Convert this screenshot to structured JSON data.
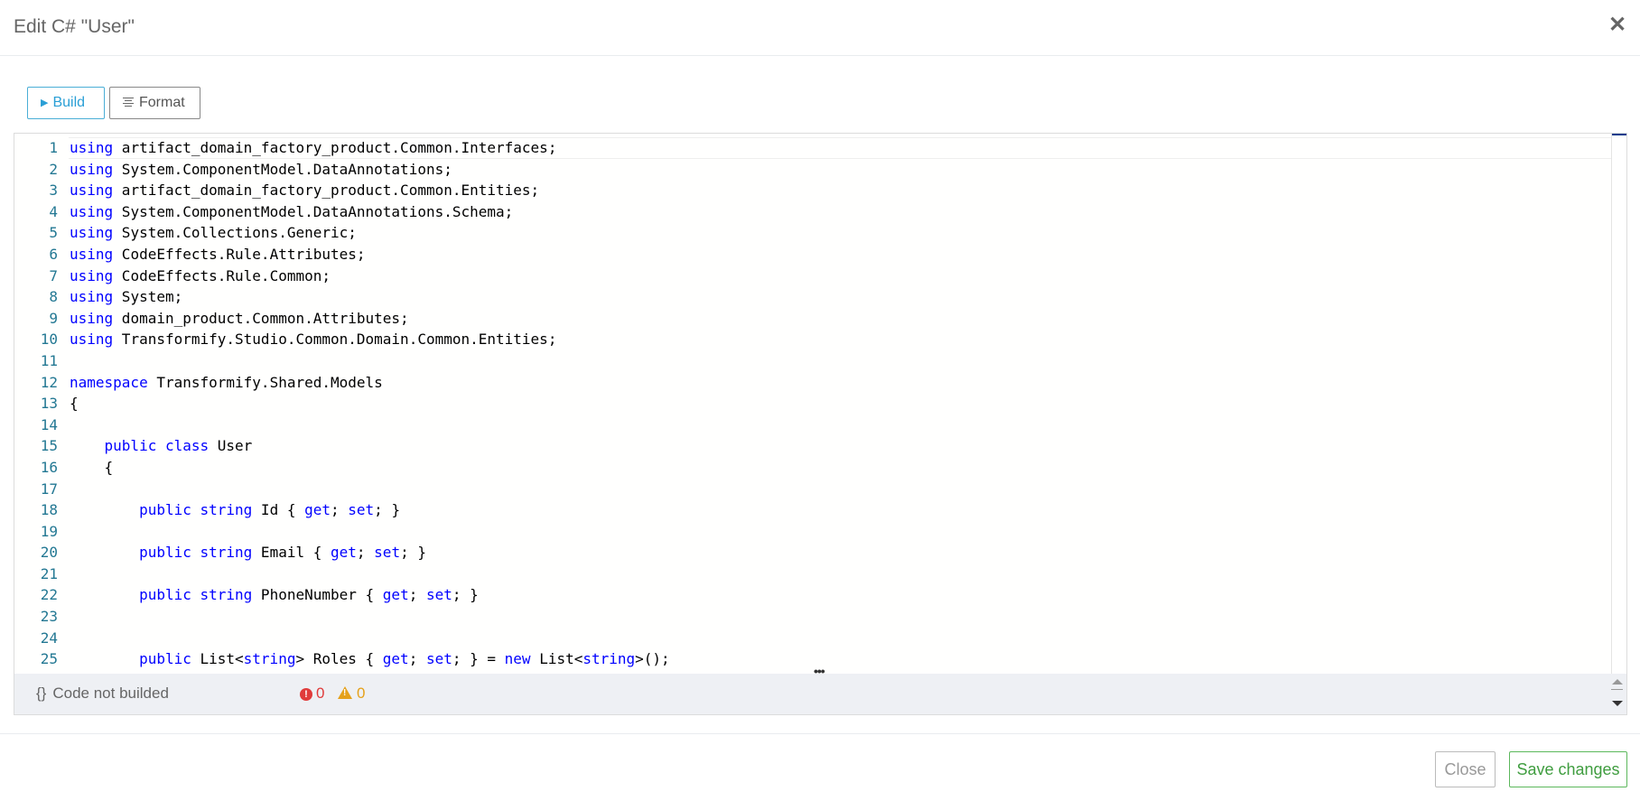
{
  "dialog": {
    "title": "Edit C# \"User\"",
    "close_symbol": "✕"
  },
  "toolbar": {
    "build_label": "Build",
    "format_label": "Format",
    "build_icon": "play-icon",
    "format_icon": "align-center-icon"
  },
  "editor": {
    "language": "C#",
    "lines": [
      {
        "n": "1",
        "indent": "",
        "tokens": [
          [
            "kw",
            "using"
          ],
          [
            "t",
            " artifact_domain_factory_product.Common.Interfaces;"
          ]
        ]
      },
      {
        "n": "2",
        "indent": "",
        "tokens": [
          [
            "kw",
            "using"
          ],
          [
            "t",
            " System.ComponentModel.DataAnnotations;"
          ]
        ]
      },
      {
        "n": "3",
        "indent": "",
        "tokens": [
          [
            "kw",
            "using"
          ],
          [
            "t",
            " artifact_domain_factory_product.Common.Entities;"
          ]
        ]
      },
      {
        "n": "4",
        "indent": "",
        "tokens": [
          [
            "kw",
            "using"
          ],
          [
            "t",
            " System.ComponentModel.DataAnnotations.Schema;"
          ]
        ]
      },
      {
        "n": "5",
        "indent": "",
        "tokens": [
          [
            "kw",
            "using"
          ],
          [
            "t",
            " System.Collections.Generic;"
          ]
        ]
      },
      {
        "n": "6",
        "indent": "",
        "tokens": [
          [
            "kw",
            "using"
          ],
          [
            "t",
            " CodeEffects.Rule.Attributes;"
          ]
        ]
      },
      {
        "n": "7",
        "indent": "",
        "tokens": [
          [
            "kw",
            "using"
          ],
          [
            "t",
            " CodeEffects.Rule.Common;"
          ]
        ]
      },
      {
        "n": "8",
        "indent": "",
        "tokens": [
          [
            "kw",
            "using"
          ],
          [
            "t",
            " System;"
          ]
        ]
      },
      {
        "n": "9",
        "indent": "",
        "tokens": [
          [
            "kw",
            "using"
          ],
          [
            "t",
            " domain_product.Common.Attributes;"
          ]
        ]
      },
      {
        "n": "10",
        "indent": "",
        "tokens": [
          [
            "kw",
            "using"
          ],
          [
            "t",
            " Transformify.Studio.Common.Domain.Common.Entities;"
          ]
        ]
      },
      {
        "n": "11",
        "indent": "",
        "tokens": []
      },
      {
        "n": "12",
        "indent": "",
        "tokens": [
          [
            "kw",
            "namespace"
          ],
          [
            "t",
            " Transformify.Shared.Models"
          ]
        ]
      },
      {
        "n": "13",
        "indent": "",
        "tokens": [
          [
            "t",
            "{"
          ]
        ]
      },
      {
        "n": "14",
        "indent": "",
        "tokens": []
      },
      {
        "n": "15",
        "indent": "    ",
        "tokens": [
          [
            "kw",
            "public"
          ],
          [
            "t",
            " "
          ],
          [
            "kw",
            "class"
          ],
          [
            "t",
            " User"
          ]
        ]
      },
      {
        "n": "16",
        "indent": "    ",
        "tokens": [
          [
            "t",
            "{"
          ]
        ]
      },
      {
        "n": "17",
        "indent": "",
        "tokens": []
      },
      {
        "n": "18",
        "indent": "        ",
        "tokens": [
          [
            "kw",
            "public"
          ],
          [
            "t",
            " "
          ],
          [
            "kw",
            "string"
          ],
          [
            "t",
            " Id { "
          ],
          [
            "kw",
            "get"
          ],
          [
            "t",
            "; "
          ],
          [
            "kw",
            "set"
          ],
          [
            "t",
            "; }"
          ]
        ]
      },
      {
        "n": "19",
        "indent": "",
        "tokens": []
      },
      {
        "n": "20",
        "indent": "        ",
        "tokens": [
          [
            "kw",
            "public"
          ],
          [
            "t",
            " "
          ],
          [
            "kw",
            "string"
          ],
          [
            "t",
            " Email { "
          ],
          [
            "kw",
            "get"
          ],
          [
            "t",
            "; "
          ],
          [
            "kw",
            "set"
          ],
          [
            "t",
            "; }"
          ]
        ]
      },
      {
        "n": "21",
        "indent": "",
        "tokens": []
      },
      {
        "n": "22",
        "indent": "        ",
        "tokens": [
          [
            "kw",
            "public"
          ],
          [
            "t",
            " "
          ],
          [
            "kw",
            "string"
          ],
          [
            "t",
            " PhoneNumber { "
          ],
          [
            "kw",
            "get"
          ],
          [
            "t",
            "; "
          ],
          [
            "kw",
            "set"
          ],
          [
            "t",
            "; }"
          ]
        ]
      },
      {
        "n": "23",
        "indent": "",
        "tokens": []
      },
      {
        "n": "24",
        "indent": "",
        "tokens": []
      },
      {
        "n": "25",
        "indent": "        ",
        "tokens": [
          [
            "kw",
            "public"
          ],
          [
            "t",
            " List<"
          ],
          [
            "kw",
            "string"
          ],
          [
            "t",
            "> Roles { "
          ],
          [
            "kw",
            "get"
          ],
          [
            "t",
            "; "
          ],
          [
            "kw",
            "set"
          ],
          [
            "t",
            "; } = "
          ],
          [
            "kw",
            "new"
          ],
          [
            "t",
            " List<"
          ],
          [
            "kw",
            "string"
          ],
          [
            "t",
            ">();"
          ]
        ]
      }
    ],
    "splitter_glyph": "•••"
  },
  "status": {
    "brace_icon": "{}",
    "build_status": "Code not builded",
    "errors": "0",
    "warnings": "0"
  },
  "footer": {
    "close_label": "Close",
    "save_label": "Save changes"
  },
  "colors": {
    "keyword": "#0000ff",
    "line_number": "#237893",
    "build_accent": "#2a9fd6",
    "save_accent": "#3f9d3f",
    "error": "#e03b3b",
    "warning": "#e5a11a"
  }
}
